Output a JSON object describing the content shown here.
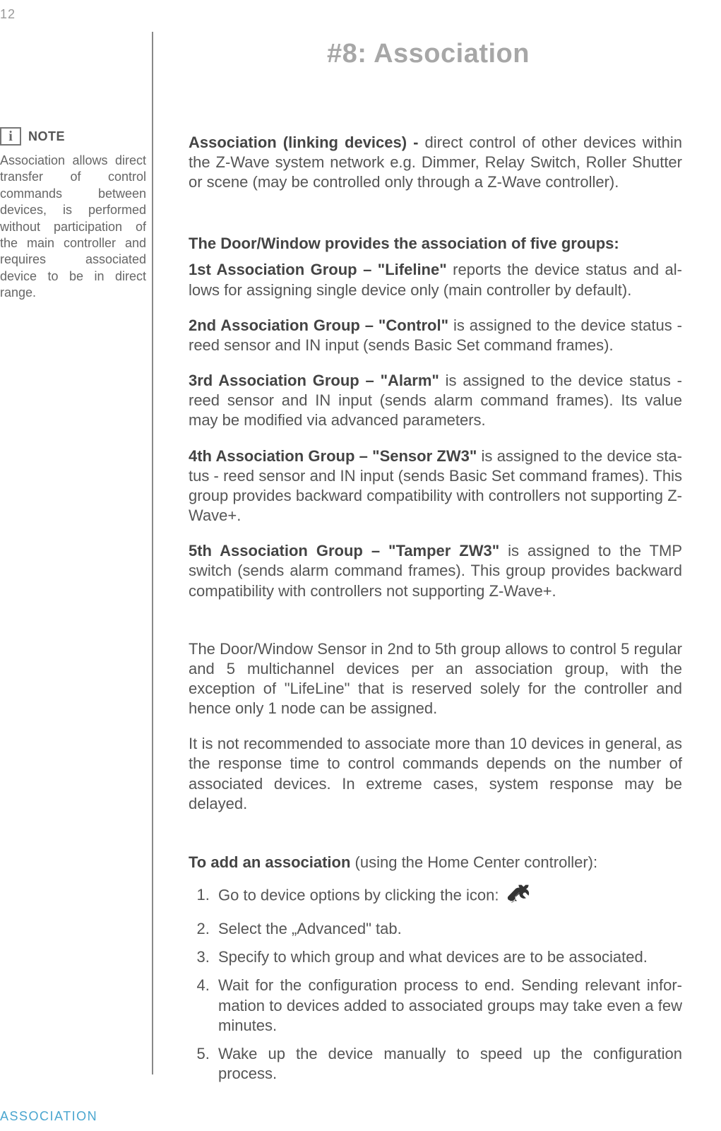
{
  "page_number": "12",
  "heading": "#8: Association",
  "note": {
    "icon_letter": "i",
    "label": "NOTE",
    "body": "Association allows di­rect transfer of control commands between devices, is performed without participation of the main controller and requires associat­ed device to be in di­rect range."
  },
  "intro_bold": "Association (linking devices) - ",
  "intro_rest": "direct control of other devices within the Z-Wave system network e.g. Dimmer, Relay Switch, Roller Shutter or scene (may be controlled only through a Z-Wave controller).",
  "groups_heading": "The Door/Window provides the association of five groups:",
  "groups": [
    {
      "bold": "1st Association Group – \"Lifeline\" ",
      "rest": "reports the device status and al­lows for assigning single device only (main controller by default)."
    },
    {
      "bold": "2nd Association Group –  \"Control\" ",
      "rest": "is assigned to the device status - reed sensor and IN input (sends Basic Set command frames)."
    },
    {
      "bold": "3rd Association Group – \"Alarm\" ",
      "rest": "is assigned to the device status - reed sensor and IN input (sends alarm command frames). Its value may be modified via advanced parameters."
    },
    {
      "bold": "4th Association Group – \"Sensor ZW3\" ",
      "rest": "is assigned to the device sta­tus - reed sensor and IN input (sends Basic Set command frames). This group provides backward compatibility with controllers not support­ing Z-Wave+."
    },
    {
      "bold": "5th Association Group – \"Tamper ZW3\" ",
      "rest": "is assigned to the TMP switch (sends alarm command frames). This group provides backward compatibility with controllers not supporting Z-Wave+."
    }
  ],
  "notes_after": [
    "The Door/Window Sensor in 2nd to 5th group allows to control 5 regular and 5 multichannel devices per an association group, with the exception of \"LifeLine\" that is reserved solely for the controller and hence only 1 node can  be assigned.",
    "It is not recommended to associate more than 10 devices in general, as the response time to control commands depends on the number of associated devices. In extreme cases, system response may be delayed."
  ],
  "add_intro_bold": "To add an association ",
  "add_intro_rest": "(using the Home Center controller):",
  "steps": [
    "Go to device options by clicking the icon:",
    "Select the „Advanced\" tab.",
    "Specify to which group and what devices are to be associated.",
    "Wait for the configuration process to end. Sending relevant infor­mation to devices added to associated groups may take even a few minutes.",
    "Wake up the device manually to speed up the configuration process."
  ],
  "footer": "ASSOCIATION"
}
